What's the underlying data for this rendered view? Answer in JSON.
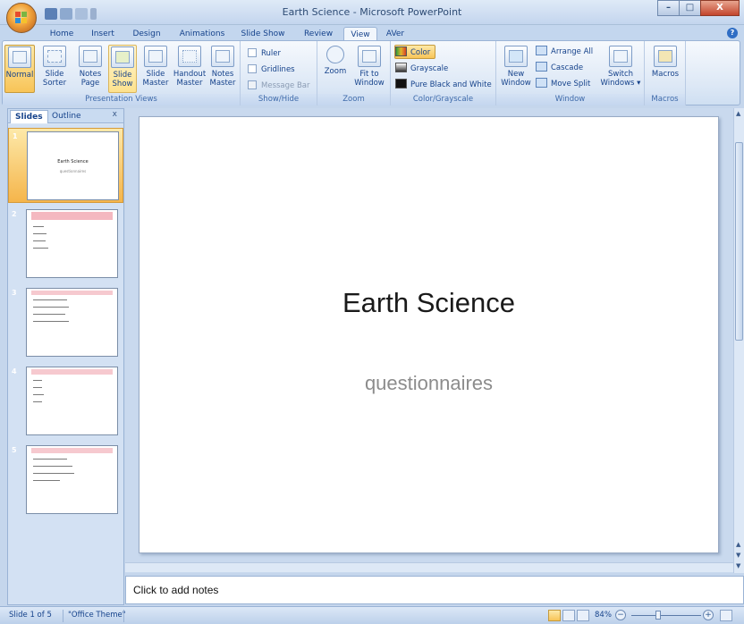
{
  "window": {
    "title": "Earth Science - Microsoft PowerPoint",
    "min": "–",
    "max": "□",
    "close": "X"
  },
  "tabs": [
    "Home",
    "Insert",
    "Design",
    "Animations",
    "Slide Show",
    "Review",
    "View",
    "AVer"
  ],
  "active_tab": "View",
  "help": "?",
  "ribbon": {
    "presentation_views": {
      "label": "Presentation Views",
      "buttons": [
        {
          "l1": "Normal",
          "l2": ""
        },
        {
          "l1": "Slide",
          "l2": "Sorter"
        },
        {
          "l1": "Notes",
          "l2": "Page"
        },
        {
          "l1": "Slide",
          "l2": "Show"
        },
        {
          "l1": "Slide",
          "l2": "Master"
        },
        {
          "l1": "Handout",
          "l2": "Master"
        },
        {
          "l1": "Notes",
          "l2": "Master"
        }
      ]
    },
    "show_hide": {
      "label": "Show/Hide",
      "items": [
        "Ruler",
        "Gridlines",
        "Message Bar"
      ]
    },
    "zoom": {
      "label": "Zoom",
      "zoom": "Zoom",
      "fit1": "Fit to",
      "fit2": "Window"
    },
    "color": {
      "label": "Color/Grayscale",
      "items": [
        "Color",
        "Grayscale",
        "Pure Black and White"
      ]
    },
    "window": {
      "label": "Window",
      "new1": "New",
      "new2": "Window",
      "items": [
        "Arrange All",
        "Cascade",
        "Move Split"
      ],
      "switch1": "Switch",
      "switch2": "Windows ▾"
    },
    "macros": {
      "label": "Macros",
      "button": "Macros"
    }
  },
  "pane": {
    "tab_slides": "Slides",
    "tab_outline": "Outline",
    "close": "x"
  },
  "thumbs": [
    {
      "num": "1",
      "title": "Earth Science",
      "subtitle": "questionnaires"
    },
    {
      "num": "2"
    },
    {
      "num": "3"
    },
    {
      "num": "4"
    },
    {
      "num": "5"
    }
  ],
  "slide": {
    "title": "Earth Science",
    "subtitle": "questionnaires"
  },
  "notes": {
    "placeholder": "Click to add notes"
  },
  "status": {
    "slide": "Slide 1 of 5",
    "theme": "\"Office Theme\"",
    "zoom": "84%",
    "minus": "−",
    "plus": "+"
  },
  "colors": {
    "accent": "#f8c457",
    "ribbon": "#dde8f6",
    "frame": "#c5d6ec"
  }
}
